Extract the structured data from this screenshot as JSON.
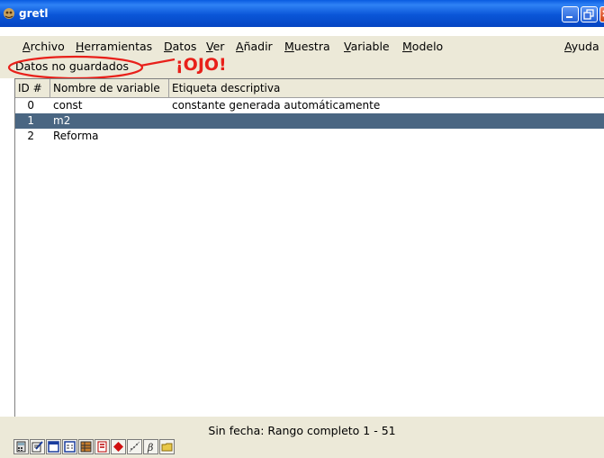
{
  "window": {
    "title": "gretl",
    "app_icon": "gretl-icon"
  },
  "menu": {
    "items": [
      {
        "label": "Archivo",
        "accel": "A"
      },
      {
        "label": "Herramientas",
        "accel": "H"
      },
      {
        "label": "Datos",
        "accel": "D"
      },
      {
        "label": "Ver",
        "accel": "V"
      },
      {
        "label": "Añadir",
        "accel": "A"
      },
      {
        "label": "Muestra",
        "accel": "M"
      },
      {
        "label": "Variable",
        "accel": "V"
      },
      {
        "label": "Modelo",
        "accel": "M"
      }
    ],
    "help": {
      "label": "Ayuda",
      "accel": "A"
    }
  },
  "status": {
    "unsaved": "Datos no guardados",
    "annotation": "¡OJO!",
    "annotation_color": "#e8201a"
  },
  "table": {
    "headers": [
      "ID #",
      "Nombre de variable",
      "Etiqueta descriptiva"
    ],
    "rows": [
      {
        "id": "0",
        "name": "const",
        "label": "constante generada automáticamente",
        "selected": false
      },
      {
        "id": "1",
        "name": "m2",
        "label": "",
        "selected": true
      },
      {
        "id": "2",
        "name": "Reforma",
        "label": "",
        "selected": false
      }
    ],
    "selection_color": "#4a6682"
  },
  "footer": {
    "range": "Sin fecha: Rango completo 1 - 51"
  },
  "toolbar": {
    "icons": [
      "calculator-icon",
      "edit-icon",
      "terminal-icon",
      "session-icon",
      "model-table-icon",
      "pdf-icon",
      "gnuplot-icon",
      "scatter-icon",
      "beta-icon",
      "open-folder-icon"
    ]
  }
}
